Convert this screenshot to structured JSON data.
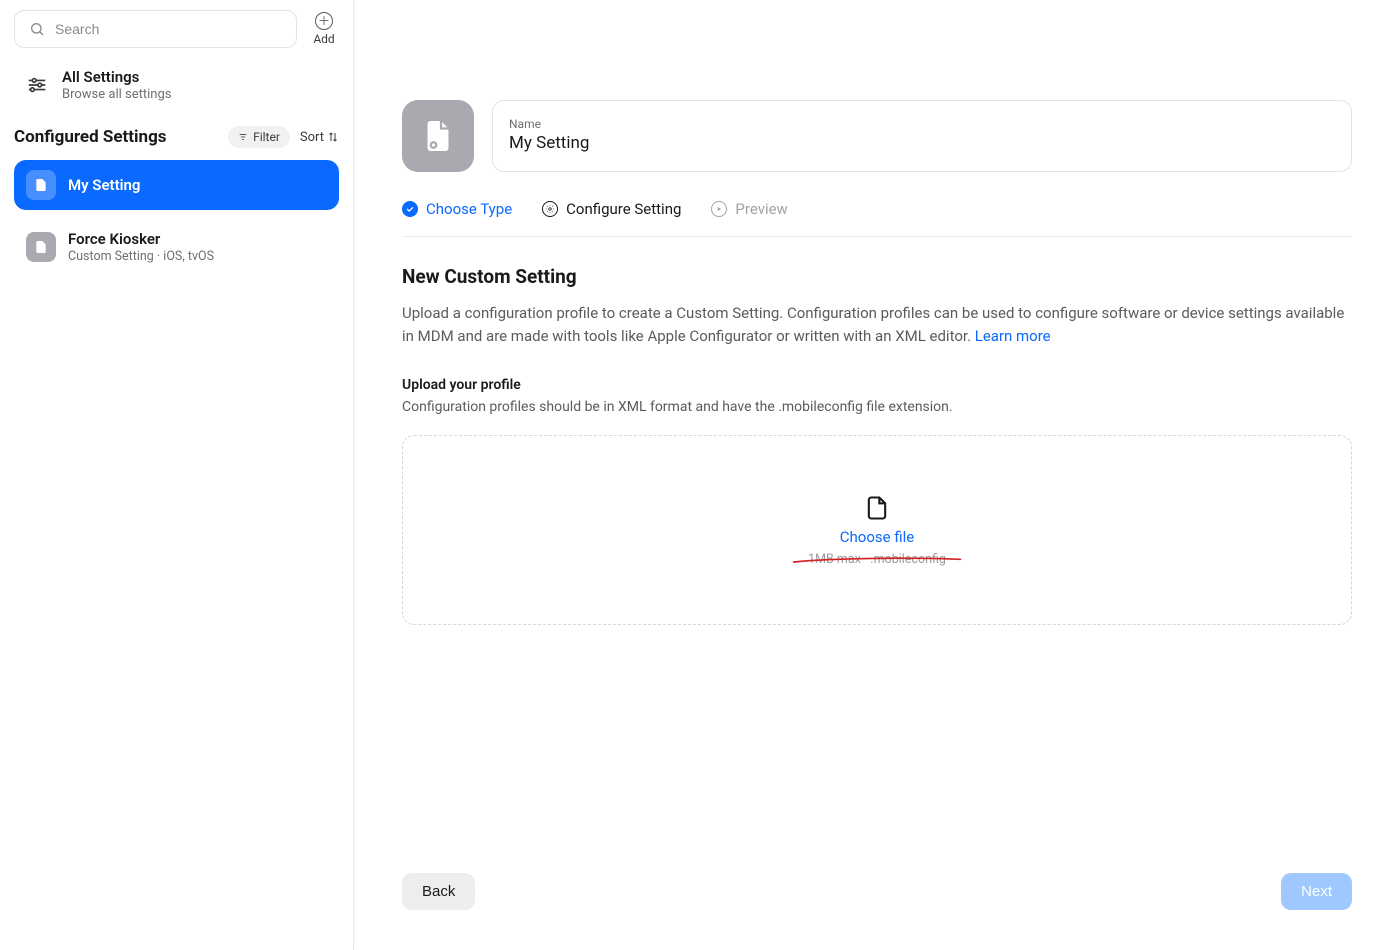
{
  "sidebar": {
    "search_placeholder": "Search",
    "add_label": "Add",
    "all_settings": {
      "title": "All Settings",
      "subtitle": "Browse all settings"
    },
    "section_title": "Configured Settings",
    "filter_label": "Filter",
    "sort_label": "Sort",
    "items": [
      {
        "title": "My Setting",
        "subtitle": ""
      },
      {
        "title": "Force Kiosker",
        "subtitle": "Custom Setting · iOS, tvOS"
      }
    ]
  },
  "main": {
    "name_label": "Name",
    "name_value": "My Setting",
    "steps": [
      {
        "label": "Choose Type"
      },
      {
        "label": "Configure Setting"
      },
      {
        "label": "Preview"
      }
    ],
    "heading": "New Custom Setting",
    "description": "Upload a configuration profile to create a Custom Setting. Configuration profiles can be used to configure software or device settings available in MDM and are made with tools like Apple Configurator or written with an XML editor. ",
    "learn_more": "Learn more",
    "upload_title": "Upload your profile",
    "upload_subtitle": "Configuration profiles should be in XML format and have the .mobileconfig file extension.",
    "choose_file": "Choose file",
    "file_hint": "1MB max · .mobileconfig",
    "back": "Back",
    "next": "Next"
  }
}
